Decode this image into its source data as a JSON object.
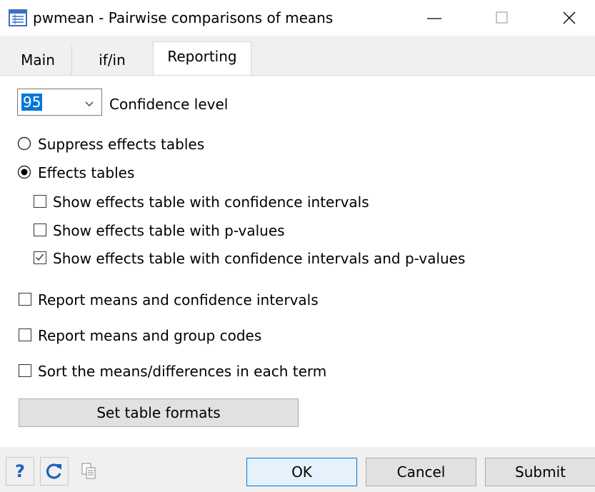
{
  "window": {
    "title": "pwmean - Pairwise comparisons of means",
    "minimize_icon": "minimize-icon",
    "maximize_icon": "maximize-icon",
    "close_icon": "close-icon"
  },
  "tabs": [
    {
      "label": "Main",
      "active": false
    },
    {
      "label": "if/in",
      "active": false
    },
    {
      "label": "Reporting",
      "active": true
    }
  ],
  "confidence": {
    "value": "95",
    "label": "Confidence level"
  },
  "radios": [
    {
      "label": "Suppress effects tables",
      "selected": false
    },
    {
      "label": "Effects tables",
      "selected": true
    }
  ],
  "effects_checks": [
    {
      "label": "Show effects table with confidence intervals",
      "checked": false
    },
    {
      "label": "Show effects table with p-values",
      "checked": false
    },
    {
      "label": "Show effects table with confidence intervals and p-values",
      "checked": true
    }
  ],
  "report_checks": [
    {
      "label": "Report means and confidence intervals",
      "checked": false
    },
    {
      "label": "Report means and group codes",
      "checked": false
    },
    {
      "label": "Sort the means/differences in each term",
      "checked": false
    }
  ],
  "set_formats_label": "Set table formats",
  "bottom": {
    "help_icon": "help-icon",
    "reset_icon": "reset-icon",
    "copy_icon": "copy-icon",
    "ok_label": "OK",
    "cancel_label": "Cancel",
    "submit_label": "Submit"
  },
  "colors": {
    "accent": "#0078d7",
    "help_blue": "#1f5fbf"
  }
}
